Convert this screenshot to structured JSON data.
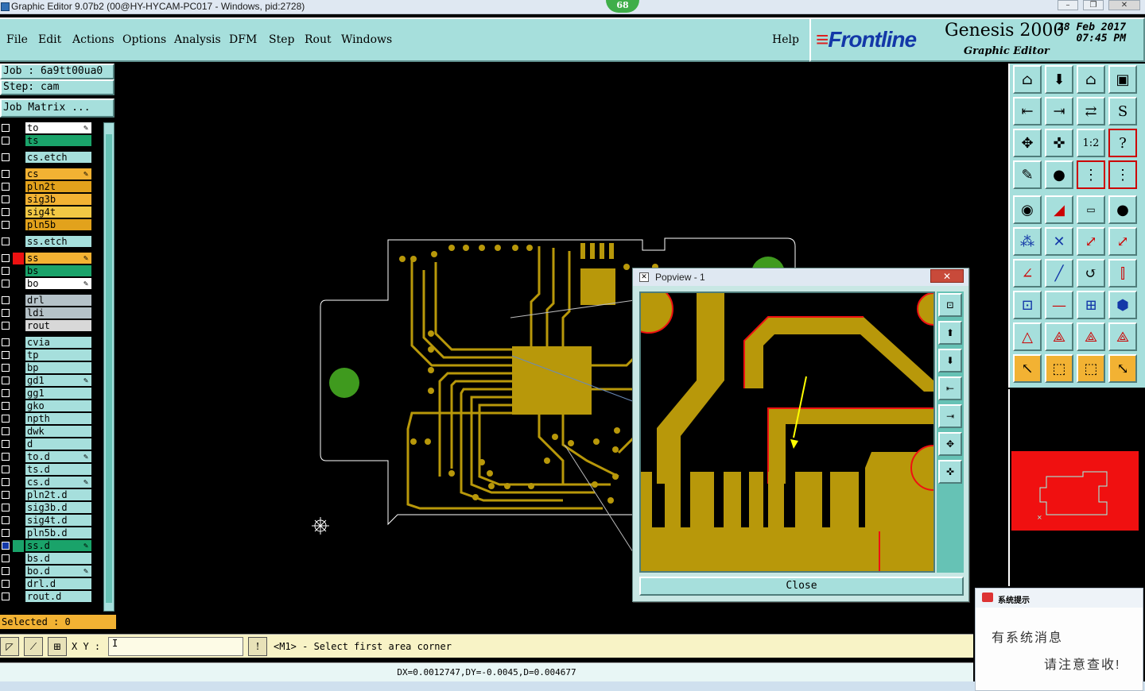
{
  "window": {
    "title": "Graphic Editor 9.07b2 (00@HY-HYCAM-PC017 - Windows, pid:2728)",
    "badge": "68"
  },
  "menu": {
    "items": [
      "File",
      "Edit",
      "Actions",
      "Options",
      "Analysis",
      "DFM",
      "Step",
      "Rout",
      "Windows"
    ],
    "help": "Help"
  },
  "brand": {
    "logo_a": "Frontline",
    "product": "Genesis 2000",
    "date": "28 Feb 2017",
    "time": "07:45 PM",
    "subtitle": "Graphic Editor"
  },
  "left": {
    "job": "Job : 6a9tt00ua0",
    "step": "Step: cam",
    "job_matrix": "Job Matrix ...",
    "selected": "Selected : 0"
  },
  "layers": [
    {
      "name": "to",
      "color": "#ffffff",
      "edit": true
    },
    {
      "name": "ts",
      "color": "#1aa36a",
      "edit": false
    },
    {
      "name": "cs.etch",
      "color": "#a6dfdc",
      "edit": false,
      "gap": true
    },
    {
      "name": "cs",
      "color": "#f2b233",
      "edit": true,
      "gap": true
    },
    {
      "name": "pln2t",
      "color": "#e2a21c",
      "edit": false
    },
    {
      "name": "sig3b",
      "color": "#f2b233",
      "edit": false
    },
    {
      "name": "sig4t",
      "color": "#f2c844",
      "edit": false
    },
    {
      "name": "pln5b",
      "color": "#e2a21c",
      "edit": false
    },
    {
      "name": "ss.etch",
      "color": "#a6dfdc",
      "edit": false,
      "gap": true
    },
    {
      "name": "ss",
      "color": "#f2b233",
      "edit": true,
      "gap": true,
      "swatch": "#e11"
    },
    {
      "name": "bs",
      "color": "#1aa36a",
      "edit": false
    },
    {
      "name": "bo",
      "color": "#ffffff",
      "edit": true
    },
    {
      "name": "drl",
      "color": "#b5c2c8",
      "edit": false,
      "gap": true
    },
    {
      "name": "ldi",
      "color": "#b5c2c8",
      "edit": false
    },
    {
      "name": "rout",
      "color": "#d8d8d8",
      "edit": false
    },
    {
      "name": "cvia",
      "color": "#a6dfdc",
      "edit": false,
      "gap": true
    },
    {
      "name": "tp",
      "color": "#a6dfdc",
      "edit": false
    },
    {
      "name": "bp",
      "color": "#a6dfdc",
      "edit": false
    },
    {
      "name": "gd1",
      "color": "#a6dfdc",
      "edit": true
    },
    {
      "name": "gg1",
      "color": "#a6dfdc",
      "edit": false
    },
    {
      "name": "gko",
      "color": "#a6dfdc",
      "edit": false
    },
    {
      "name": "npth",
      "color": "#a6dfdc",
      "edit": false
    },
    {
      "name": "dwk",
      "color": "#a6dfdc",
      "edit": false
    },
    {
      "name": "d",
      "color": "#a6dfdc",
      "edit": false
    },
    {
      "name": "to.d",
      "color": "#a6dfdc",
      "edit": true
    },
    {
      "name": "ts.d",
      "color": "#a6dfdc",
      "edit": false
    },
    {
      "name": "cs.d",
      "color": "#a6dfdc",
      "edit": true
    },
    {
      "name": "pln2t.d",
      "color": "#a6dfdc",
      "edit": false
    },
    {
      "name": "sig3b.d",
      "color": "#a6dfdc",
      "edit": false
    },
    {
      "name": "sig4t.d",
      "color": "#a6dfdc",
      "edit": false
    },
    {
      "name": "pln5b.d",
      "color": "#a6dfdc",
      "edit": false
    },
    {
      "name": "ss.d",
      "color": "#1aa36a",
      "edit": true,
      "swatch": "#1aa36a",
      "checked": true
    },
    {
      "name": "bs.d",
      "color": "#a6dfdc",
      "edit": false
    },
    {
      "name": "bo.d",
      "color": "#a6dfdc",
      "edit": true
    },
    {
      "name": "drl.d",
      "color": "#a6dfdc",
      "edit": false
    },
    {
      "name": "rout.d",
      "color": "#a6dfdc",
      "edit": false
    }
  ],
  "popview": {
    "title": "Popview - 1",
    "close_x": "✕",
    "close": "Close"
  },
  "bottom": {
    "xy_label": "X Y :",
    "xy_value": "I",
    "prompt": "<M1> - Select first area corner",
    "coords": "DX=0.0012747,DY=-0.0045,D=0.004677"
  },
  "notify": {
    "header": "系统提示",
    "line1": "有系统消息",
    "line2": "请注意查收!"
  },
  "colors": {
    "panel": "#a6dfdc",
    "copper": "#b8980a",
    "board_outline": "#ffffff"
  }
}
